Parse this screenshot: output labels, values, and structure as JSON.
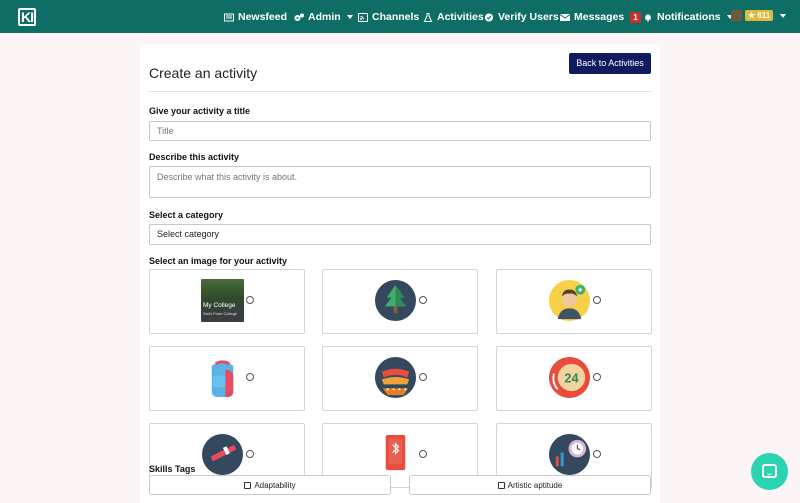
{
  "nav": {
    "logo_text": "KI",
    "items": [
      {
        "label": "Newsfeed",
        "icon": "newspaper-icon"
      },
      {
        "label": "Admin",
        "icon": "cogs-icon"
      },
      {
        "label": "Channels",
        "icon": "rss-icon"
      },
      {
        "label": "Activities",
        "icon": "flask-icon"
      },
      {
        "label": "Verify Users",
        "icon": "check-circle-icon"
      },
      {
        "label": "Messages",
        "icon": "envelope-icon",
        "badge": "1"
      },
      {
        "label": "Notifications",
        "icon": "bell-icon"
      }
    ],
    "points": "611",
    "points_icon": "star-icon"
  },
  "page": {
    "title": "Create an activity",
    "back_button": "Back to Activities"
  },
  "form": {
    "title_label": "Give your activity a title",
    "title_placeholder": "Title",
    "description_label": "Describe this activity",
    "description_placeholder": "Describe what this activity is about.",
    "category_label": "Select a category",
    "category_value": "Select category",
    "image_label": "Select an image for your activity",
    "images": [
      {
        "name": "my-college-photo",
        "caption": "My College",
        "subcaption": "Sixth Form College"
      },
      {
        "name": "pine-tree-icon"
      },
      {
        "name": "graduate-person-icon"
      },
      {
        "name": "backpack-icon"
      },
      {
        "name": "hotdog-icon"
      },
      {
        "name": "24-hour-clock-icon"
      },
      {
        "name": "telescope-icon"
      },
      {
        "name": "mobile-phone-icon"
      },
      {
        "name": "stopwatch-icon"
      }
    ],
    "skills_label": "Skills Tags",
    "skills": [
      "Adaptability",
      "Artistic aptitude"
    ]
  },
  "colors": {
    "nav_bg": "#0e6e65",
    "button_bg": "#101a5e",
    "chat_bg": "#2bd4b0",
    "badge_red": "#c9302c",
    "points_gold": "#e0b93a"
  }
}
